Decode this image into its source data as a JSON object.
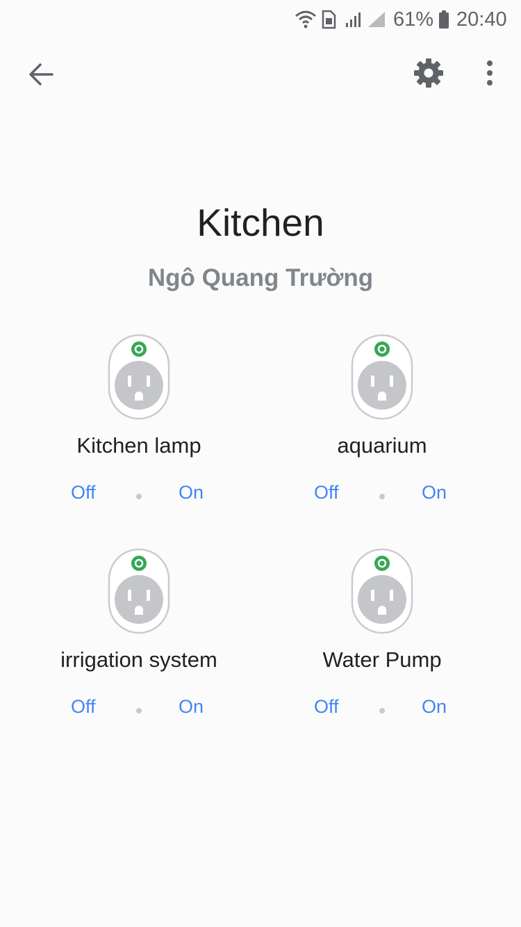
{
  "status_bar": {
    "battery_percent": "61%",
    "time": "20:40",
    "icons": [
      "wifi-icon",
      "sim-icon",
      "signal-icon",
      "signal-icon",
      "battery-icon"
    ]
  },
  "app_bar": {
    "icons": [
      "back-arrow-icon",
      "gear-icon",
      "more-vertical-icon"
    ]
  },
  "room": {
    "title": "Kitchen",
    "owner": "Ngô Quang Trường"
  },
  "devices": [
    {
      "name": "Kitchen lamp",
      "off_label": "Off",
      "on_label": "On",
      "icon": "smart-plug-icon"
    },
    {
      "name": "aquarium",
      "off_label": "Off",
      "on_label": "On",
      "icon": "smart-plug-icon"
    },
    {
      "name": "irrigation system",
      "off_label": "Off",
      "on_label": "On",
      "icon": "smart-plug-icon"
    },
    {
      "name": "Water Pump",
      "off_label": "Off",
      "on_label": "On",
      "icon": "smart-plug-icon"
    }
  ],
  "colors": {
    "accent": "#4285f4",
    "plug_indicator": "#34a853",
    "plug_body": "#c4c6c9",
    "subtitle": "#80868b",
    "icon": "#5f6368"
  }
}
